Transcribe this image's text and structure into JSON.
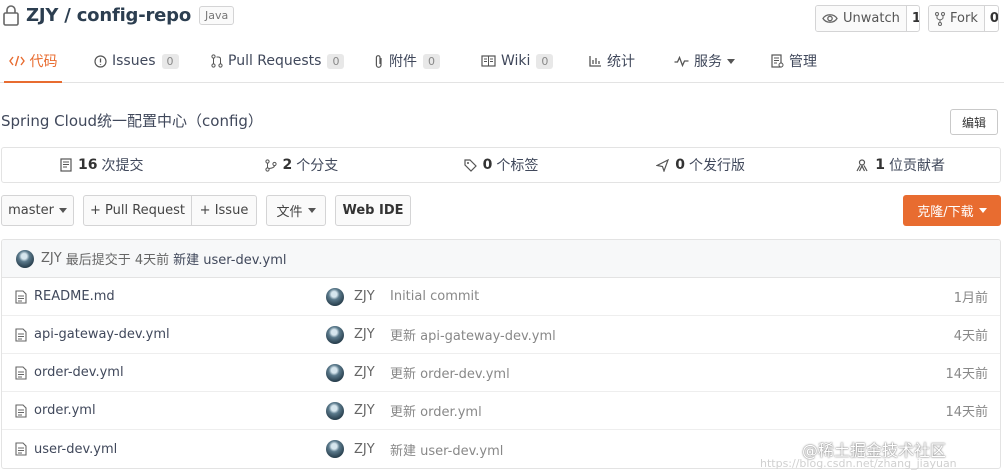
{
  "repo": {
    "title": "ZJY / config-repo",
    "language": "Java"
  },
  "header_buttons": {
    "watch": {
      "label": "Unwatch",
      "count": "1"
    },
    "fork": {
      "label": "Fork",
      "count": "0"
    }
  },
  "tabs": [
    {
      "label": "代码",
      "active": true
    },
    {
      "label": "Issues",
      "badge": "0"
    },
    {
      "label": "Pull Requests",
      "badge": "0"
    },
    {
      "label": "附件",
      "badge": "0"
    },
    {
      "label": "Wiki",
      "badge": "0"
    },
    {
      "label": "统计"
    },
    {
      "label": "服务"
    },
    {
      "label": "管理"
    }
  ],
  "description": "Spring Cloud统一配置中心（config）",
  "edit_label": "编辑",
  "stats": [
    {
      "count": "16",
      "label": "次提交",
      "icon": "commit-icon"
    },
    {
      "count": "2",
      "label": "个分支",
      "icon": "branch-icon"
    },
    {
      "count": "0",
      "label": "个标签",
      "icon": "tag-icon"
    },
    {
      "count": "0",
      "label": "个发行版",
      "icon": "release-icon"
    },
    {
      "count": "1",
      "label": "位贡献者",
      "icon": "contributors-icon"
    }
  ],
  "toolbar": {
    "branch": "master",
    "pull_request": "+ Pull Request",
    "issue": "+ Issue",
    "file": "文件",
    "web_ide": "Web IDE",
    "clone": "克隆/下载"
  },
  "last_commit": {
    "author": "ZJY",
    "text": "最后提交于 4天前",
    "message": "新建 user-dev.yml"
  },
  "files": [
    {
      "name": "README.md",
      "author": "ZJY",
      "message": "Initial commit",
      "time": "1月前"
    },
    {
      "name": "api-gateway-dev.yml",
      "author": "ZJY",
      "message": "更新 api-gateway-dev.yml",
      "time": "4天前"
    },
    {
      "name": "order-dev.yml",
      "author": "ZJY",
      "message": "更新 order-dev.yml",
      "time": "14天前"
    },
    {
      "name": "order.yml",
      "author": "ZJY",
      "message": "更新 order.yml",
      "time": "14天前"
    },
    {
      "name": "user-dev.yml",
      "author": "ZJY",
      "message": "新建 user-dev.yml",
      "time": ""
    }
  ],
  "watermark": {
    "main": "@稀土掘金技术社区",
    "sub": "https://blog.csdn.net/zhang_jiayuan"
  },
  "colors": {
    "accent": "#e86c30",
    "text": "#40485b",
    "border": "#e3e3e3"
  }
}
